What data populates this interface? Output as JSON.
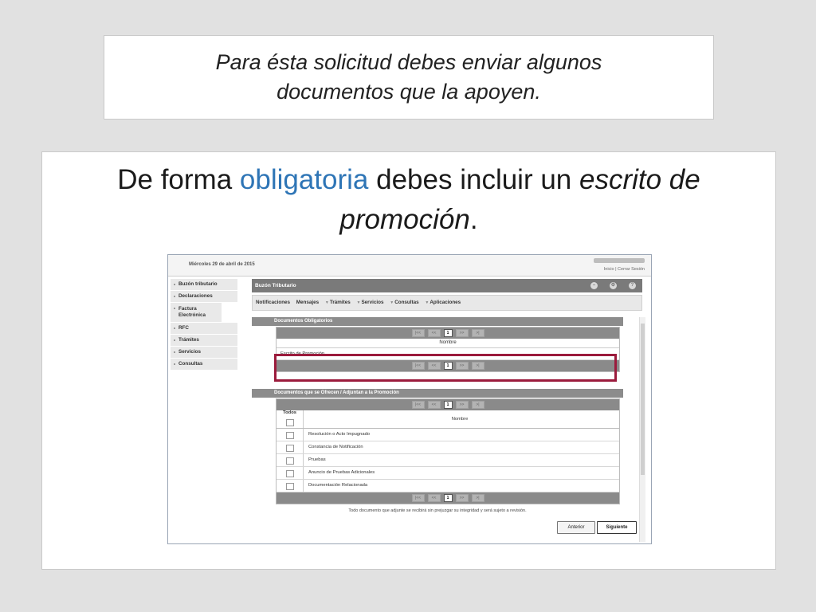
{
  "slide": {
    "top_text_line1": "Para ésta solicitud debes enviar algunos",
    "top_text_line2": "documentos que la apoyen.",
    "headline_part1": "De forma ",
    "headline_highlight": "obligatoria",
    "headline_part2": " debes incluir un ",
    "headline_italic1": "escrito de",
    "headline_italic2": "promoción",
    "headline_end": "."
  },
  "portal": {
    "date": "Miércoles 29 de abril de 2015",
    "header_links": "Inicio | Cerrar Sesión",
    "sidebar": [
      {
        "label": "Buzón tributario"
      },
      {
        "label": "Declaraciones"
      },
      {
        "label": "Factura Electrónica"
      },
      {
        "label": "RFC"
      },
      {
        "label": "Trámites"
      },
      {
        "label": "Servicios"
      },
      {
        "label": "Consultas"
      }
    ],
    "title": "Buzón Tributario",
    "title_icons": [
      "minimize-icon",
      "settings-icon",
      "help-icon"
    ],
    "menu": [
      {
        "label": "Notificaciones",
        "caret": false
      },
      {
        "label": "Mensajes",
        "caret": false
      },
      {
        "label": "Trámites",
        "caret": true
      },
      {
        "label": "Servicios",
        "caret": true
      },
      {
        "label": "Consultas",
        "caret": true
      },
      {
        "label": "Aplicaciones",
        "caret": true
      }
    ],
    "pager": {
      "first": "|<<",
      "prev": "<<",
      "page": "1",
      "next": ">>",
      "last": ">|"
    },
    "required_docs": {
      "heading": "Documentos Obligatorios",
      "column": "Nombre",
      "rows": [
        "Escrito de Promoción"
      ]
    },
    "offered_docs": {
      "heading": "Documentos que se Ofrecen / Adjuntan a la Promoción",
      "col_all": "Todos",
      "column": "Nombre",
      "rows": [
        "Resolución o Acto Impugnado",
        "Constancia de Notificación",
        "Pruebas",
        "Anuncio de Pruebas Adicionales",
        "Documentación Relacionada"
      ]
    },
    "note": "Todo documento que adjunte se recibirá sin prejuzgar su integridad y será sujeto a revisión.",
    "buttons": {
      "back": "Anterior",
      "next": "Siguiente"
    },
    "highlight_color": "#9b1b3c"
  }
}
